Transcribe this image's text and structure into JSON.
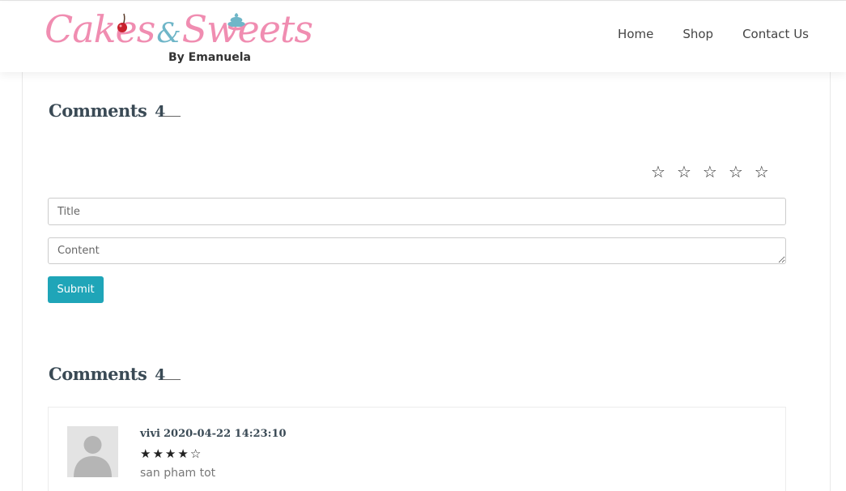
{
  "brand": {
    "logo_text_1": "Cakes",
    "logo_amp": "&",
    "logo_text_2": "Sweets",
    "byline": "By Emanuela",
    "pink": "#f08db1",
    "teal": "#6fb6c8"
  },
  "nav": {
    "items": [
      {
        "label": "Home"
      },
      {
        "label": "Shop"
      },
      {
        "label": "Contact Us"
      }
    ]
  },
  "comment_form": {
    "heading": "Comments",
    "count": "4",
    "rating": {
      "value": 0,
      "max": 5,
      "icon": "star-outline-icon"
    },
    "title_placeholder": "Title",
    "content_placeholder": "Content",
    "submit_label": "Submit",
    "accent": "#1fa5b8"
  },
  "comments_section": {
    "heading": "Comments",
    "count": "4",
    "comments": [
      {
        "author": "vivi",
        "date": "2020-04-22 14:23:10",
        "rating": 4,
        "rating_max": 5,
        "text": "san pham tot",
        "avatar_icon": "user-placeholder-icon"
      }
    ]
  }
}
